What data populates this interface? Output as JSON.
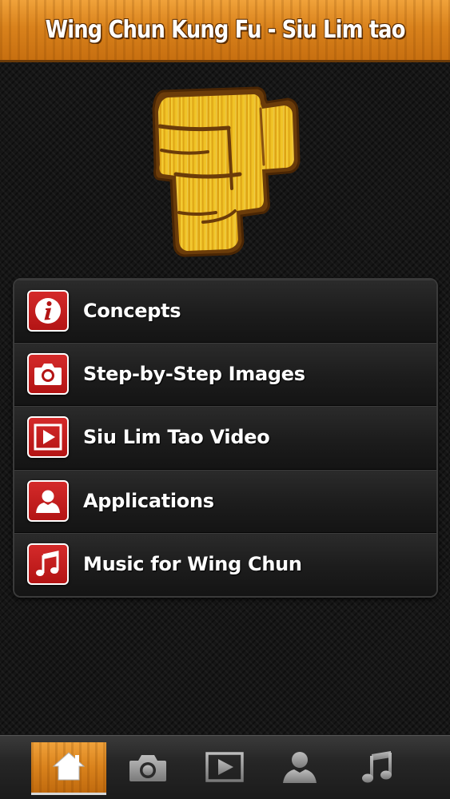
{
  "header": {
    "title": "Wing Chun Kung Fu - Siu Lim tao"
  },
  "logo": {
    "icon": "fist-logo-icon"
  },
  "menu": {
    "items": [
      {
        "label": "Concepts",
        "icon": "info-icon"
      },
      {
        "label": "Step-by-Step Images",
        "icon": "camera-icon"
      },
      {
        "label": "Siu Lim Tao Video",
        "icon": "video-play-icon"
      },
      {
        "label": "Applications",
        "icon": "person-icon"
      },
      {
        "label": "Music for Wing Chun",
        "icon": "music-note-icon"
      }
    ]
  },
  "tabbar": {
    "tabs": [
      {
        "icon": "home-icon",
        "active": true
      },
      {
        "icon": "camera-icon",
        "active": false
      },
      {
        "icon": "video-play-icon",
        "active": false
      },
      {
        "icon": "person-icon",
        "active": false
      },
      {
        "icon": "music-note-icon",
        "active": false
      }
    ]
  },
  "colors": {
    "header_wood": "#d9821c",
    "icon_red": "#c21e1e",
    "background": "#161616",
    "text": "#ffffff"
  }
}
